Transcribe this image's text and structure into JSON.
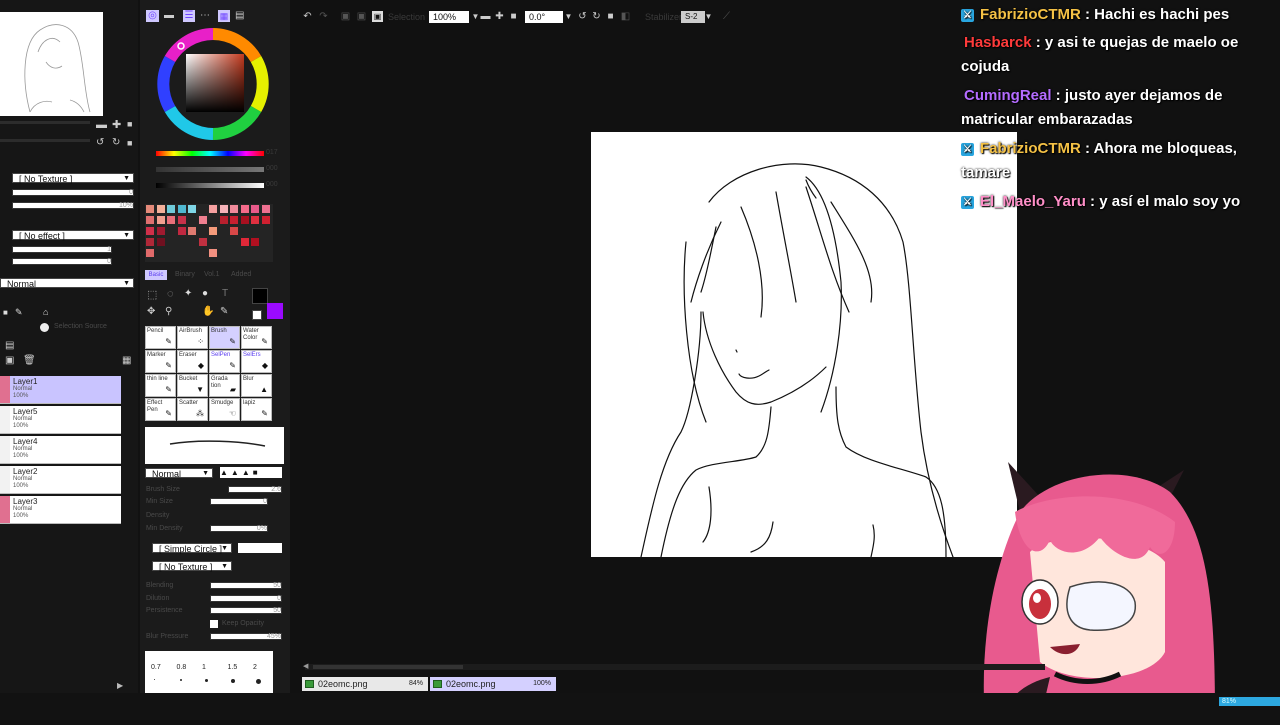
{
  "app": {
    "toolbar": {
      "zoom": "100%",
      "rotation": "0.0°",
      "stabilizer_label": "Stabilizer",
      "stabilizer_value": "S-2",
      "selection_label": "Selection"
    }
  },
  "left_panel": {
    "texture_select": "[ No Texture ]",
    "texture_value": "0",
    "texture_pct": "10%",
    "effect_select": "[ No effect ]",
    "effect_v1": "1",
    "effect_v2": "0",
    "blend_mode": "Normal",
    "selection_source": "Selection Source",
    "layers": [
      {
        "name": "Layer1",
        "mode": "Normal",
        "opacity": "100%",
        "active": true
      },
      {
        "name": "Layer5",
        "mode": "Normal",
        "opacity": "100%",
        "active": false
      },
      {
        "name": "Layer4",
        "mode": "Normal",
        "opacity": "100%",
        "active": false
      },
      {
        "name": "Layer2",
        "mode": "Normal",
        "opacity": "100%",
        "active": false
      },
      {
        "name": "Layer3",
        "mode": "Normal",
        "opacity": "100%",
        "active": false
      }
    ]
  },
  "tools_panel": {
    "palette_tabs": [
      "Basic",
      "Binary",
      "Vol.1",
      "Added"
    ],
    "value_readouts": [
      "017",
      "000",
      "000"
    ],
    "tools": [
      {
        "label": "Pencil",
        "glyph": "✎",
        "active": false,
        "blue": false
      },
      {
        "label": "AirBrush",
        "glyph": "⁘",
        "active": false,
        "blue": false
      },
      {
        "label": "Brush",
        "glyph": "✎",
        "active": true,
        "blue": false
      },
      {
        "label": "Water Color",
        "glyph": "✎",
        "active": false,
        "blue": false
      },
      {
        "label": "Marker",
        "glyph": "✎",
        "active": false,
        "blue": false
      },
      {
        "label": "Eraser",
        "glyph": "◆",
        "active": false,
        "blue": false
      },
      {
        "label": "SelPen",
        "glyph": "✎",
        "active": false,
        "blue": true
      },
      {
        "label": "SelErs",
        "glyph": "◆",
        "active": false,
        "blue": true
      },
      {
        "label": "thin line",
        "glyph": "✎",
        "active": false,
        "blue": false
      },
      {
        "label": "Bucket",
        "glyph": "▼",
        "active": false,
        "blue": false
      },
      {
        "label": "Grada tion",
        "glyph": "▰",
        "active": false,
        "blue": false
      },
      {
        "label": "Blur",
        "glyph": "▲",
        "active": false,
        "blue": false
      },
      {
        "label": "Effect Pen",
        "glyph": "✎",
        "active": false,
        "blue": false
      },
      {
        "label": "Scatter",
        "glyph": "⁂",
        "active": false,
        "blue": false
      },
      {
        "label": "Smudge",
        "glyph": "☜",
        "active": false,
        "blue": false
      },
      {
        "label": "lapiz",
        "glyph": "✎",
        "active": false,
        "blue": false
      }
    ],
    "brush_mode": "Normal",
    "brush_size_label": "Brush Size",
    "brush_size_value": "2.6",
    "min_size_label": "Min Size",
    "min_size_value": "0",
    "density_label": "Density",
    "min_density_label": "Min Density",
    "min_density_value": "0%",
    "shape_select": "[ Simple Circle ]",
    "texture_select": "[ No Texture ]",
    "blending_label": "Blending",
    "blending_value": "50",
    "dilution_label": "Dilution",
    "dilution_value": "0",
    "persistence_label": "Persistence",
    "persistence_value": "50",
    "keep_opacity_label": "Keep Opacity",
    "blur_pressure_label": "Blur Pressure",
    "blur_pressure_value": "45%",
    "brush_sizes": [
      "0.7",
      "0.8",
      "1",
      "1.5",
      "2"
    ]
  },
  "chat": [
    {
      "user": "FabrizioCTMR",
      "user_color": "#f4c145",
      "badge": true,
      "message": "Hachi es hachi pes"
    },
    {
      "user": "Hasbarck",
      "user_color": "#ff3b3b",
      "badge": false,
      "message": "y asi te quejas de maelo oe cojuda"
    },
    {
      "user": "CumingReal",
      "user_color": "#b46cff",
      "badge": false,
      "message": "justo ayer dejamos de matricular embarazadas"
    },
    {
      "user": "FabrizioCTMR",
      "user_color": "#f4c145",
      "badge": true,
      "message": "Ahora me bloqueas, tamare"
    },
    {
      "user": "El_Maelo_Yaru",
      "user_color": "#ff8fc8",
      "badge": true,
      "message": "y así el malo soy yo"
    }
  ],
  "documents": [
    {
      "name": "02eomc.png",
      "zoom": "84%"
    },
    {
      "name": "02eomc.png",
      "zoom": "100%"
    }
  ],
  "status": {
    "memory": "81%"
  },
  "colors": {
    "chat_badge": "#29a6e0",
    "active_layer": "#c9c4ff",
    "current_color": "#9b0aff"
  }
}
